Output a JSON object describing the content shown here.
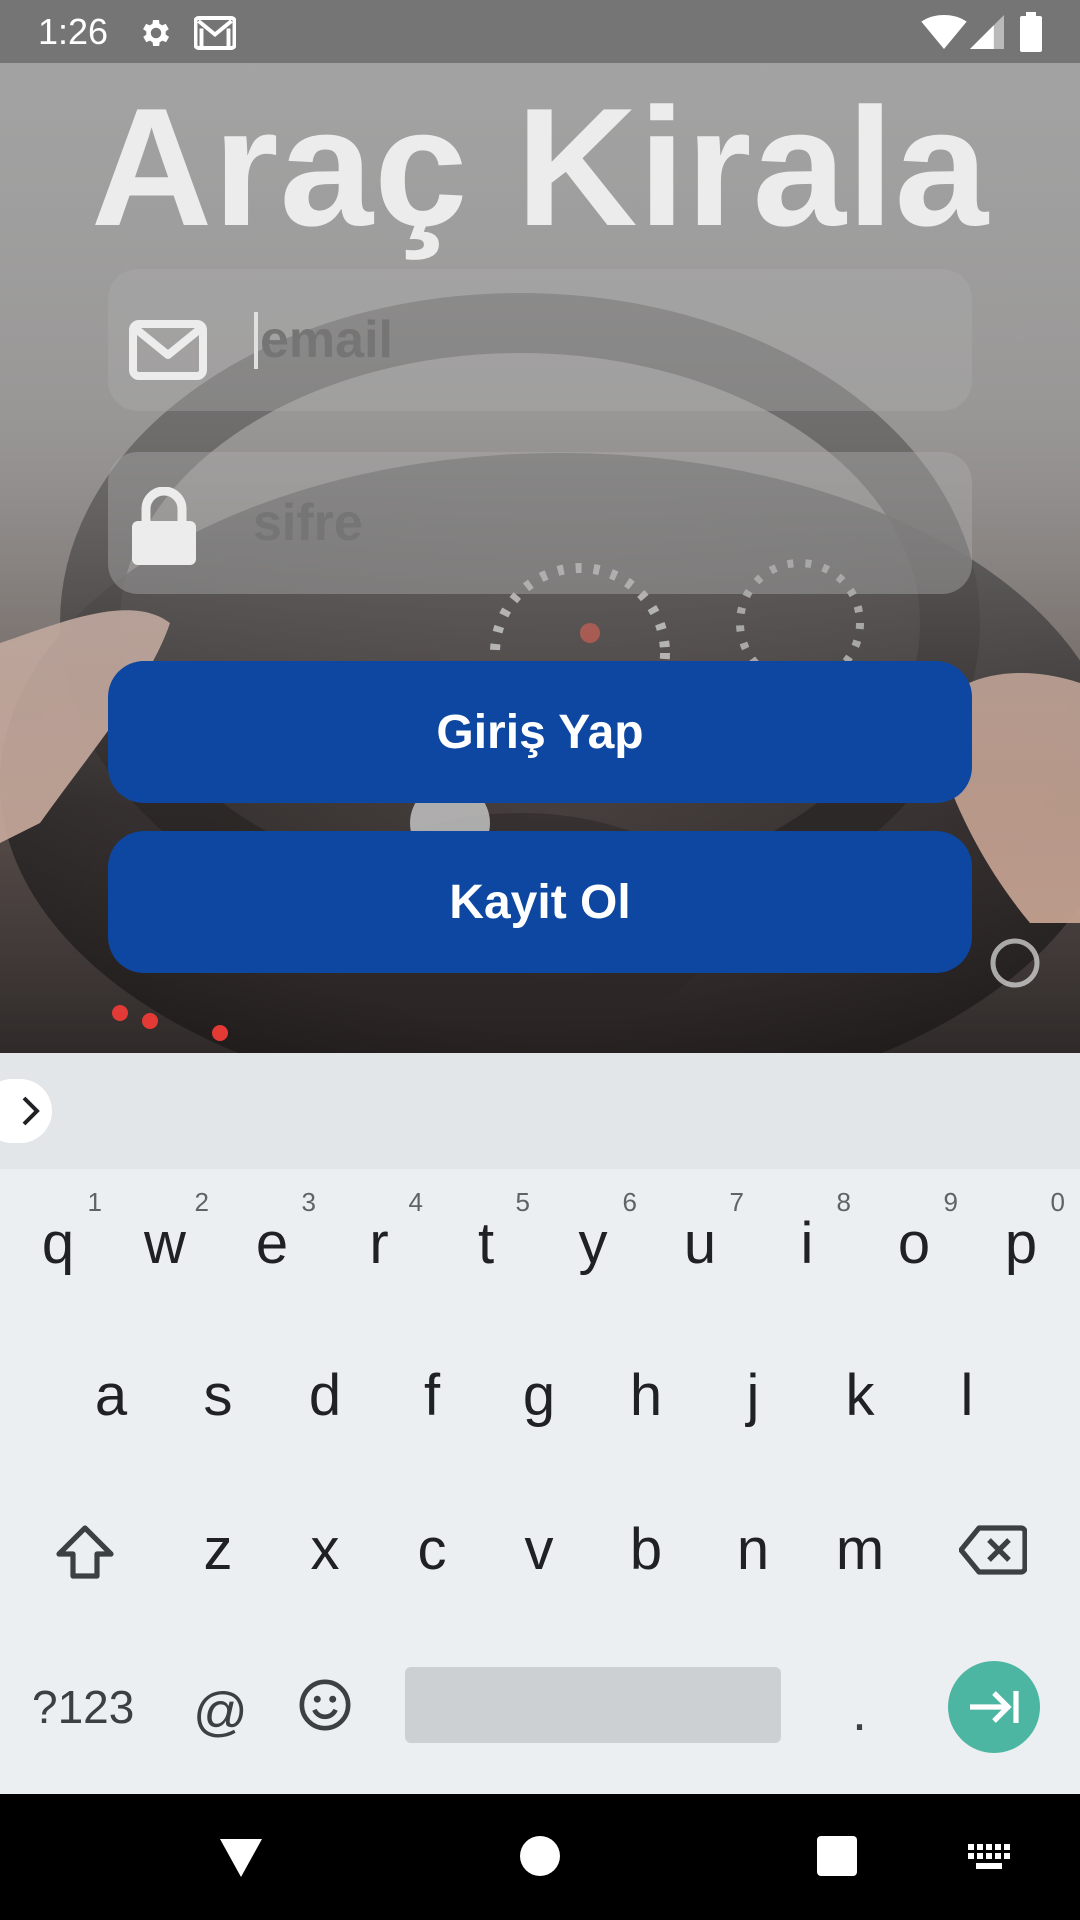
{
  "status_bar": {
    "time": "1:26",
    "icons": [
      "gear-icon",
      "gmail-icon",
      "wifi-icon",
      "signal-icon",
      "battery-icon"
    ],
    "background_color": "#757575"
  },
  "app": {
    "title": "Araç Kirala",
    "email": {
      "value": "",
      "placeholder": "email",
      "icon": "mail-icon",
      "focused": true
    },
    "password": {
      "value": "",
      "placeholder": "sifre",
      "icon": "lock-icon"
    },
    "login_button": "Giriş Yap",
    "register_button": "Kayit Ol",
    "button_color": "#0d47a1"
  },
  "keyboard": {
    "row1": [
      {
        "key": "q",
        "hint": "1"
      },
      {
        "key": "w",
        "hint": "2"
      },
      {
        "key": "e",
        "hint": "3"
      },
      {
        "key": "r",
        "hint": "4"
      },
      {
        "key": "t",
        "hint": "5"
      },
      {
        "key": "y",
        "hint": "6"
      },
      {
        "key": "u",
        "hint": "7"
      },
      {
        "key": "i",
        "hint": "8"
      },
      {
        "key": "o",
        "hint": "9"
      },
      {
        "key": "p",
        "hint": "0"
      }
    ],
    "row2": [
      "a",
      "s",
      "d",
      "f",
      "g",
      "h",
      "j",
      "k",
      "l"
    ],
    "row3": [
      "z",
      "x",
      "c",
      "v",
      "b",
      "n",
      "m"
    ],
    "symbols_key": "?123",
    "at_key": "@",
    "period_key": ".",
    "enter_color": "#4db6a3"
  },
  "nav_bar": {
    "icons": [
      "back-icon",
      "home-icon",
      "recents-icon",
      "keyboard-switch-icon"
    ]
  }
}
